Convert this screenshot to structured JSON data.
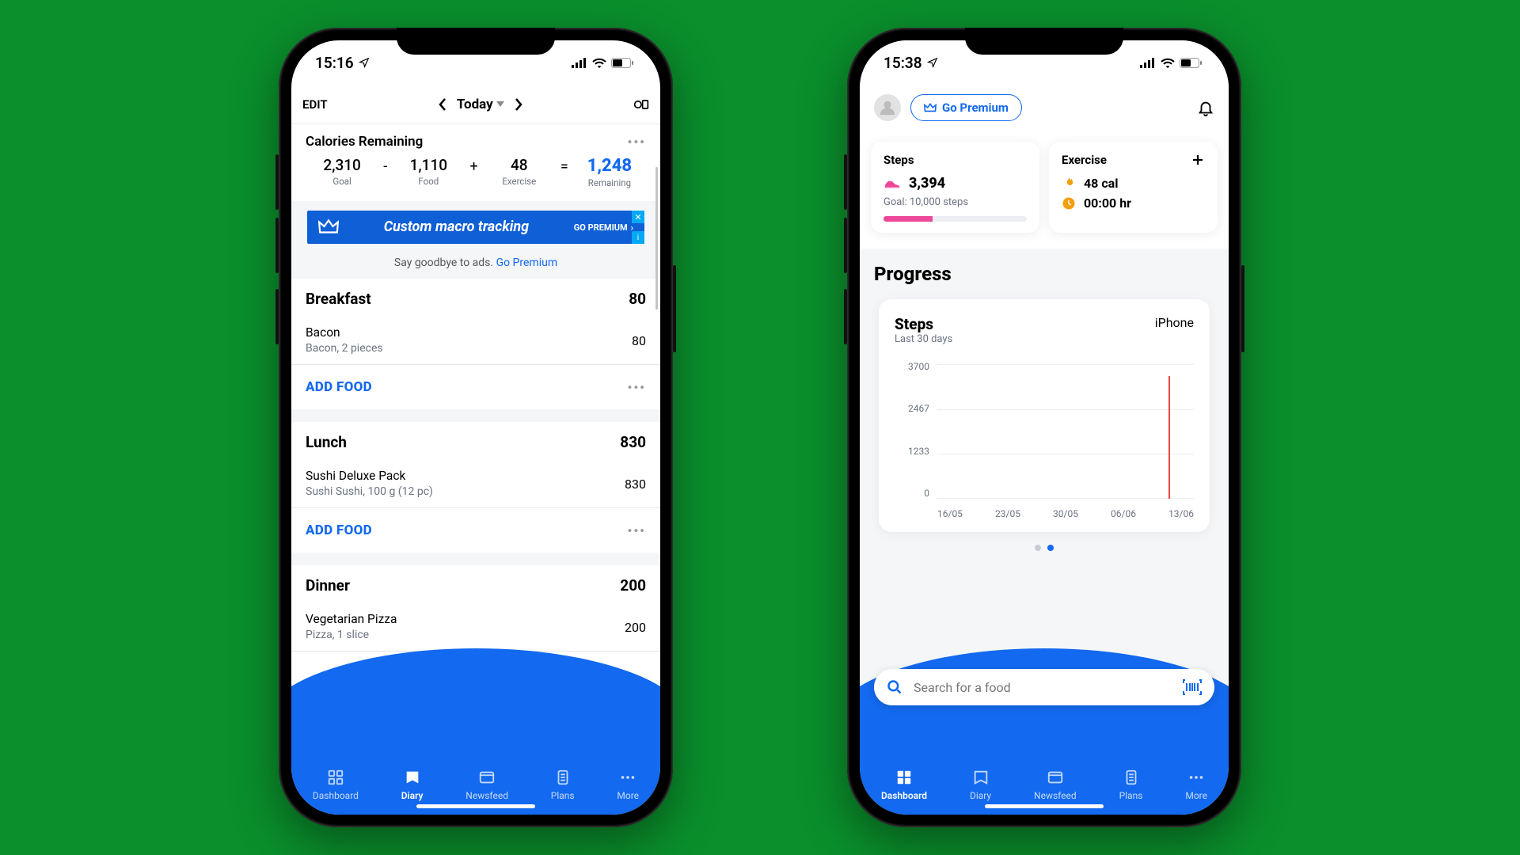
{
  "phone1": {
    "status_time": "15:16",
    "header": {
      "edit": "EDIT",
      "date": "Today"
    },
    "calories": {
      "title": "Calories Remaining",
      "goal": {
        "v": "2,310",
        "l": "Goal"
      },
      "food": {
        "v": "1,110",
        "l": "Food"
      },
      "exercise": {
        "v": "48",
        "l": "Exercise"
      },
      "remaining": {
        "v": "1,248",
        "l": "Remaining"
      },
      "minus": "-",
      "plus": "+",
      "eq": "="
    },
    "ad": {
      "title": "Custom macro tracking",
      "cta": "GO PREMIUM",
      "note_prefix": "Say goodbye to ads. ",
      "note_link": "Go Premium"
    },
    "meals": [
      {
        "name": "Breakfast",
        "cal": "80",
        "items": [
          {
            "n": "Bacon",
            "d": "Bacon, 2 pieces",
            "c": "80"
          }
        ],
        "add": "ADD FOOD"
      },
      {
        "name": "Lunch",
        "cal": "830",
        "items": [
          {
            "n": "Sushi Deluxe Pack",
            "d": "Sushi Sushi, 100 g (12 pc)",
            "c": "830"
          }
        ],
        "add": "ADD FOOD"
      },
      {
        "name": "Dinner",
        "cal": "200",
        "items": [
          {
            "n": "Vegetarian Pizza",
            "d": "Pizza, 1 slice",
            "c": "200"
          }
        ],
        "add": "ADD FOOD"
      }
    ],
    "tabs": [
      "Dashboard",
      "Diary",
      "Newsfeed",
      "Plans",
      "More"
    ]
  },
  "phone2": {
    "status_time": "15:38",
    "premium": "Go Premium",
    "steps": {
      "title": "Steps",
      "value": "3,394",
      "goal": "Goal: 10,000 steps"
    },
    "exercise": {
      "title": "Exercise",
      "cal": "48 cal",
      "time": "00:00 hr"
    },
    "progress": {
      "title": "Progress",
      "card_title": "Steps",
      "subtitle": "Last 30 days",
      "device": "iPhone"
    },
    "search": {
      "placeholder": "Search for a food"
    },
    "tabs": [
      "Dashboard",
      "Diary",
      "Newsfeed",
      "Plans",
      "More"
    ]
  },
  "chart_data": {
    "type": "bar",
    "title": "Steps — Last 30 days",
    "ylabel": "Steps",
    "ylim": [
      0,
      3700
    ],
    "y_ticks": [
      0,
      1233,
      2467,
      3700
    ],
    "categories": [
      "16/05",
      "23/05",
      "30/05",
      "06/06",
      "13/06"
    ],
    "values": [
      0,
      0,
      0,
      0,
      3394
    ],
    "device": "iPhone"
  }
}
